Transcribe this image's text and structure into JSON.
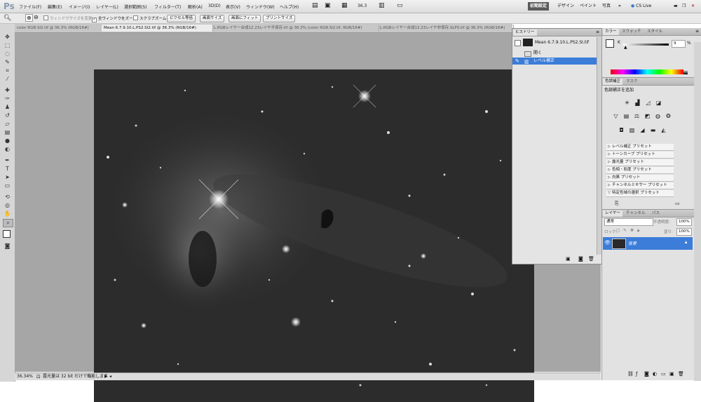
{
  "app": {
    "logo": "Ps"
  },
  "menu": {
    "items": [
      "ファイル(F)",
      "編集(E)",
      "イメージ(I)",
      "レイヤー(L)",
      "選択範囲(S)",
      "フィルター(T)",
      "解析(A)",
      "3D(D)",
      "表示(V)",
      "ウィンドウ(W)",
      "ヘルプ(H)"
    ],
    "zoom": "36.3",
    "workspaces": [
      "初期設定",
      "デザイン",
      "ペイント",
      "写真"
    ],
    "more": "»",
    "cslive": "CS Live"
  },
  "options": {
    "resize_windows": "ウィンドウサイズを変更",
    "all_windows_zoom": "全ウィンドウをズーム",
    "scrubby_zoom": "スクラブズーム",
    "actual_pixels": "ピクセル等倍",
    "fit_screen": "画面サイズ",
    "fill_screen": "画面にフィット",
    "print_size": "プリントサイズ"
  },
  "doc_tabs": [
    "color RGB.SI2.tif @ 36.3% (RGB/16#)",
    "Mean 6.7.9.10.L.PS2.SI2.tif @ 36.3% (RGB/16#)",
    "L.RGBレイヤー合成12.23レイヤ不保存.tif @ 36.3% (color RGB.SI2.tif, RGB/16#)",
    "L.RGBレイヤー合成12.23レイヤ非保存.SLPS.tif @ 36.3% (RGB/16#)"
  ],
  "status": {
    "zoom": "36.34%",
    "message": "露光量は 32 bit だけで機能します"
  },
  "history": {
    "tab": "ヒストリー",
    "snapshot": "Mean 6.7.9.10.L.PS2.SI.tif",
    "items": [
      "開く",
      "レベル補正"
    ]
  },
  "color_panel": {
    "tabs": [
      "カラー",
      "スウォッチ",
      "スタイル"
    ],
    "channel": "K",
    "value": "9",
    "unit": "%"
  },
  "adjust_panel": {
    "tabs": [
      "色調補正",
      "マスク"
    ],
    "title": "色調補正を追加",
    "presets": [
      "レベル補正 プリセット",
      "トーンカーブ プリセット",
      "露光量 プリセット",
      "色相・彩度 プリセット",
      "白黒 プリセット",
      "チャンネルミキサー プリセット",
      "特定色域の選択 プリセット"
    ]
  },
  "layers_panel": {
    "tabs": [
      "レイヤー",
      "チャンネル",
      "パス"
    ],
    "blend_mode": "通常",
    "opacity_label": "不透明度:",
    "opacity": "100%",
    "lock_label": "ロック:",
    "fill_label": "塗り:",
    "fill": "100%",
    "layer_name": "背景"
  }
}
